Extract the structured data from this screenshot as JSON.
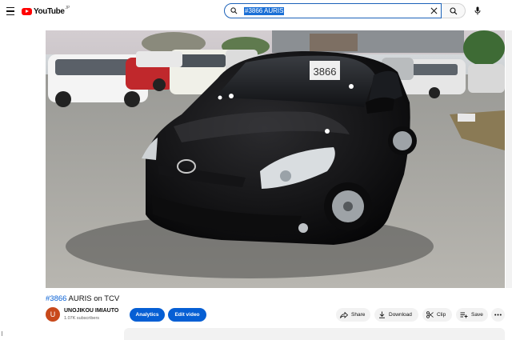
{
  "header": {
    "logo_text": "YouTube",
    "logo_region": "JP",
    "search": {
      "value": "#3866 AURIS",
      "placeholder": "Search"
    }
  },
  "video": {
    "hashtag": "#3866",
    "title_rest": " AURIS on TCV"
  },
  "channel": {
    "avatar_letter": "U",
    "name": "UNOJIKOU IMIAUTO",
    "subscribers": "1.07K subscribers"
  },
  "actions": {
    "analytics": "Analytics",
    "edit_video": "Edit video",
    "share": "Share",
    "download": "Download",
    "clip": "Clip",
    "save": "Save"
  },
  "scene": {
    "windshield_tag": "3866"
  },
  "colors": {
    "accent_blue": "#065fd4",
    "brand_red": "#ff0000",
    "avatar_bg": "#c8491b"
  }
}
